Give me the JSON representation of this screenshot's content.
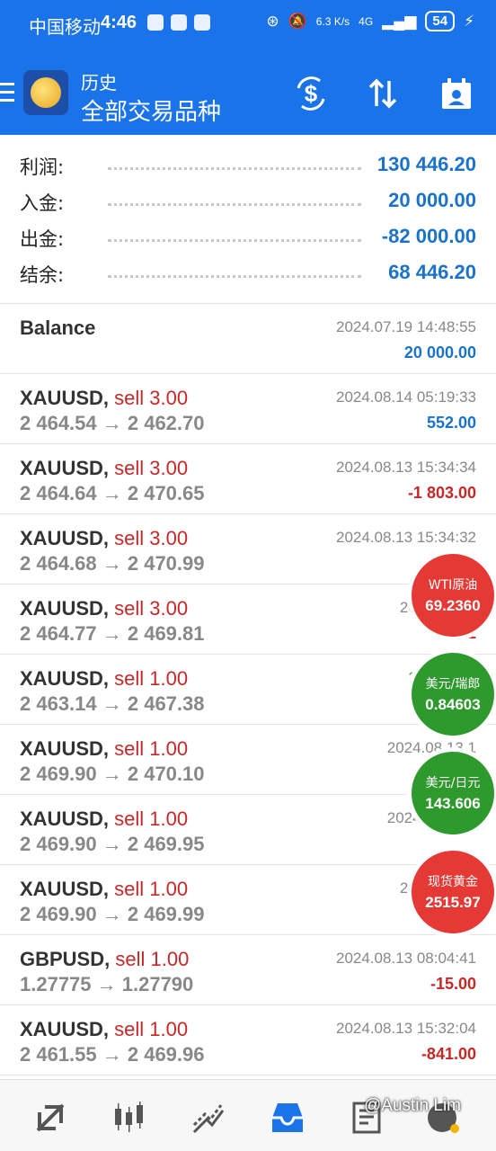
{
  "status_bar": {
    "carrier": "中国移动",
    "time": "4:46",
    "net_speed": "6.3 K/s",
    "network": "4G",
    "battery": "54"
  },
  "header": {
    "subtitle": "历史",
    "title": "全部交易品种",
    "icons": [
      "menu-icon",
      "app-logo",
      "currency-exchange-icon",
      "sort-icon",
      "calendar-icon"
    ]
  },
  "summary": [
    {
      "label": "利润:",
      "value": "130 446.20"
    },
    {
      "label": "入金:",
      "value": "20 000.00"
    },
    {
      "label": "出金:",
      "value": "-82 000.00"
    },
    {
      "label": "结余:",
      "value": "68 446.20"
    }
  ],
  "balance": {
    "label": "Balance",
    "time": "2024.07.19 14:48:55",
    "value": "20 000.00"
  },
  "deals": [
    {
      "symbol": "XAUUSD,",
      "side": "sell 3.00",
      "prices": "2 464.54 → 2 462.70",
      "time": "2024.08.14 05:19:33",
      "pnl": "552.00",
      "sign": "pos"
    },
    {
      "symbol": "XAUUSD,",
      "side": "sell 3.00",
      "prices": "2 464.64 → 2 470.65",
      "time": "2024.08.13 15:34:34",
      "pnl": "-1 803.00",
      "sign": "neg"
    },
    {
      "symbol": "XAUUSD,",
      "side": "sell 3.00",
      "prices": "2 464.68 → 2 470.99",
      "time": "2024.08.13 15:34:32",
      "pnl": "",
      "sign": "neg"
    },
    {
      "symbol": "XAUUSD,",
      "side": "sell 3.00",
      "prices": "2 464.77 → 2 469.81",
      "time": "2024.08.13",
      "pnl": "-1",
      "sign": "neg"
    },
    {
      "symbol": "XAUUSD,",
      "side": "sell 1.00",
      "prices": "2 463.14 → 2 467.38",
      "time": "2024.08.1",
      "pnl": "",
      "sign": "neg"
    },
    {
      "symbol": "XAUUSD,",
      "side": "sell 1.00",
      "prices": "2 469.90 → 2 470.10",
      "time": "2024.08.13 1",
      "pnl": "",
      "sign": "neg"
    },
    {
      "symbol": "XAUUSD,",
      "side": "sell 1.00",
      "prices": "2 469.90 → 2 469.95",
      "time": "2024.08.13 1",
      "pnl": "",
      "sign": "neg"
    },
    {
      "symbol": "XAUUSD,",
      "side": "sell 1.00",
      "prices": "2 469.90 → 2 469.99",
      "time": "2024.08.13",
      "pnl": "",
      "sign": "neg"
    },
    {
      "symbol": "GBPUSD,",
      "side": "sell 1.00",
      "prices": "1.27775 → 1.27790",
      "time": "2024.08.13 08:04:41",
      "pnl": "-15.00",
      "sign": "neg"
    },
    {
      "symbol": "XAUUSD,",
      "side": "sell 1.00",
      "prices": "2 461.55 → 2 469.96",
      "time": "2024.08.13 15:32:04",
      "pnl": "-841.00",
      "sign": "neg"
    }
  ],
  "bubbles": [
    {
      "name": "WTI原油",
      "value": "69.2360",
      "color": "#e53935"
    },
    {
      "name": "美元/瑞郎",
      "value": "0.84603",
      "color": "#2e9a2e"
    },
    {
      "name": "美元/日元",
      "value": "143.606",
      "color": "#2e9a2e"
    },
    {
      "name": "现货黄金",
      "value": "2515.97",
      "color": "#e53935"
    }
  ],
  "bottom_nav": [
    "quotes-icon",
    "chart-icon",
    "trade-icon",
    "history-icon",
    "news-icon",
    "messages-icon"
  ],
  "watermark": "@Austin Lim",
  "colors": {
    "header": "#1a73e8",
    "positive": "#1a73c8",
    "negative": "#c62828"
  }
}
